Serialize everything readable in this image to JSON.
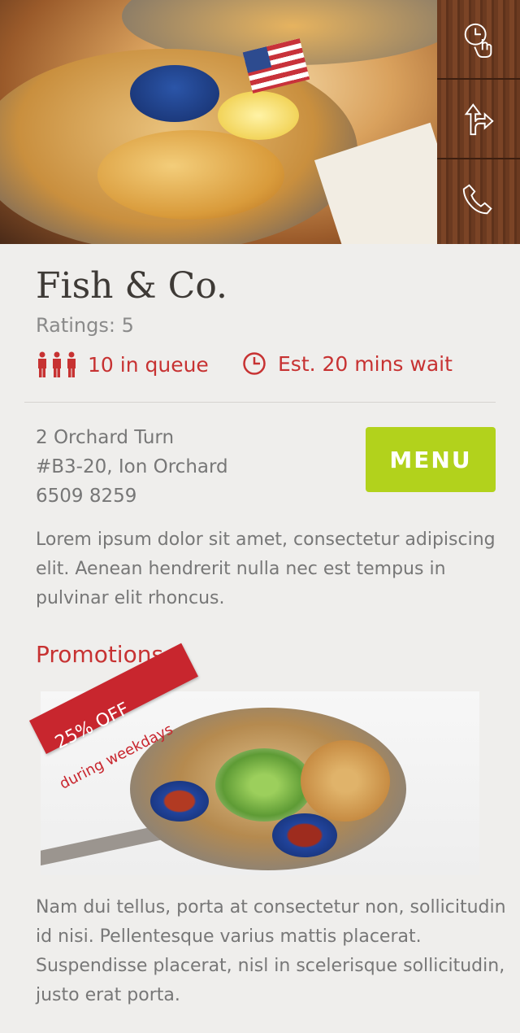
{
  "restaurant": {
    "name": "Fish & Co.",
    "ratings": "Ratings: 5",
    "queue": "10 in queue",
    "wait": "Est. 20 mins wait"
  },
  "address": {
    "line1": "2 Orchard Turn",
    "line2": "#B3-20, Ion Orchard",
    "phone": "6509 8259"
  },
  "menu_button": "MENU",
  "description": "Lorem ipsum dolor sit amet, consectetur adipiscing elit. Aenean hendrerit nulla nec est tempus in pulvinar elit rhoncus.",
  "promotions": {
    "heading": "Promotions",
    "badge_main": "25% OFF",
    "badge_sub": "during weekdays",
    "description": "Nam dui tellus, porta at consectetur non, sollicitudin id nisi. Pellentesque varius mattis placerat. Suspendisse placerat, nisl in scelerisque sollicitudin, justo erat porta."
  },
  "side_actions": [
    {
      "icon": "clock-tap-icon"
    },
    {
      "icon": "directions-icon"
    },
    {
      "icon": "phone-icon"
    }
  ],
  "colors": {
    "accent_red": "#c73232",
    "menu_green": "#b2d21c",
    "background": "#efeeec"
  }
}
